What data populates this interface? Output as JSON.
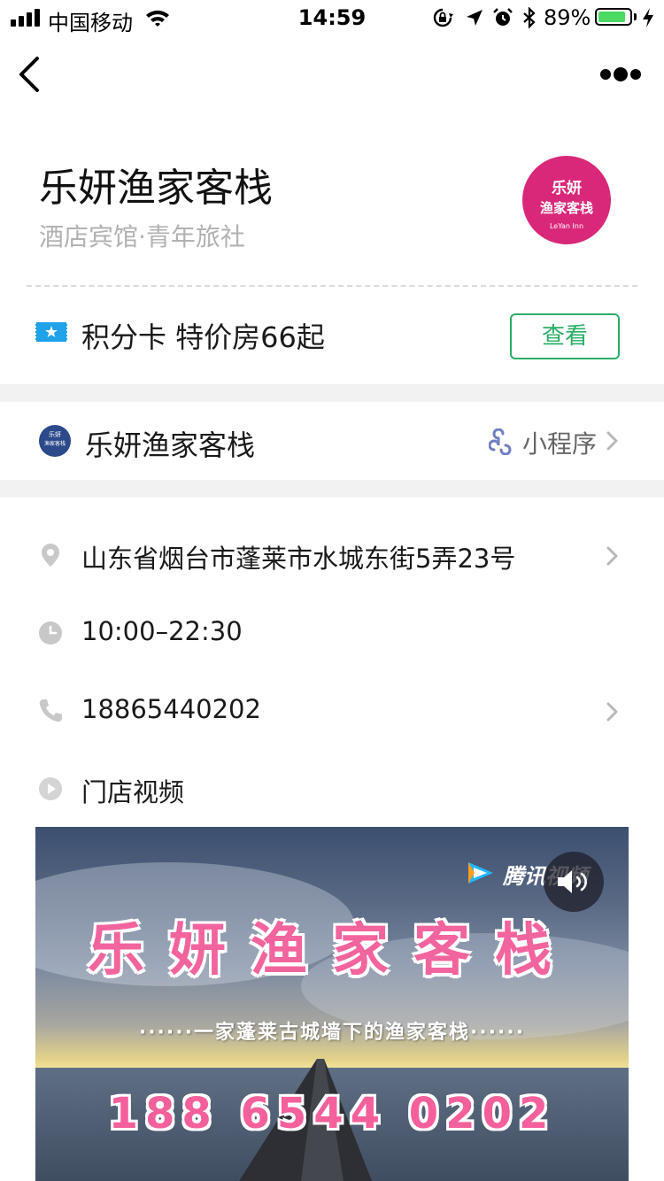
{
  "status_bar": {
    "carrier": "中国移动",
    "time": "14:59",
    "battery_percent": "89%",
    "battery_level": 0.89,
    "icons": [
      "signal-icon",
      "wifi-icon",
      "orientation-lock-icon",
      "location-arrow-icon",
      "alarm-icon",
      "bluetooth-icon",
      "battery-icon",
      "charging-icon"
    ]
  },
  "nav": {
    "back_icon": "chevron-left-icon",
    "more_icon": "more-dots-icon"
  },
  "header": {
    "title": "乐妍渔家客栈",
    "category": "酒店宾馆·青年旅社",
    "logo": {
      "line1": "乐妍",
      "line2": "渔家客栈",
      "line3": "LeYan Inn",
      "color": "#d9287a"
    }
  },
  "card_row": {
    "icon": "membership-card-icon",
    "text": "积分卡 特价房66起",
    "button_label": "查看",
    "accent_color": "#2aae67"
  },
  "mini_program": {
    "avatar_line1": "乐妍",
    "avatar_line2": "渔家客栈",
    "name": "乐妍渔家客栈",
    "link_icon": "mini-program-icon",
    "label": "小程序"
  },
  "info": {
    "address": "山东省烟台市蓬莱市水城东街5弄23号",
    "hours": "10:00–22:30",
    "phone": "18865440202",
    "video_label": "门店视频"
  },
  "video": {
    "brand": "腾讯视频",
    "title": "乐妍渔家客栈",
    "slogan": "······一家蓬莱古城墙下的渔家客栈······",
    "phone": "188 6544 0202",
    "mute_icon": "speaker-sound-icon"
  }
}
